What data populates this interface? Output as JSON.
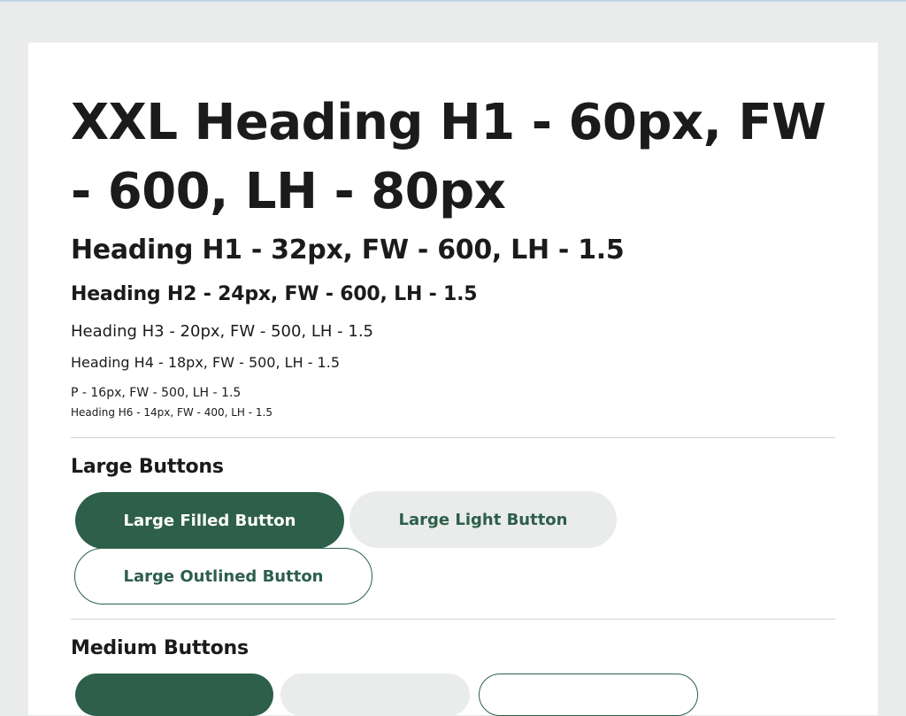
{
  "typography": {
    "xxl_heading": "XXL Heading H1 - 60px, FW - 600, LH - 80px",
    "h1": "Heading H1 - 32px, FW - 600, LH - 1.5",
    "h2": "Heading H2 - 24px, FW - 600, LH - 1.5",
    "h3": "Heading H3 - 20px, FW - 500, LH - 1.5",
    "h4": "Heading H4 - 18px, FW - 500, LH - 1.5",
    "p": "P - 16px, FW - 500, LH - 1.5",
    "h6": "Heading H6 - 14px, FW - 400, LH - 1.5"
  },
  "large_buttons": {
    "title": "Large Buttons",
    "filled_label": "Large Filled Button",
    "light_label": "Large Light Button",
    "outlined_label": "Large Outlined Button"
  },
  "medium_buttons": {
    "title": "Medium Buttons"
  },
  "colors": {
    "page_background": "#e9eceb",
    "card_background": "#ffffff",
    "primary": "#2d5f4a",
    "light_button": "#e9eceb",
    "divider": "#d3d3d3"
  }
}
